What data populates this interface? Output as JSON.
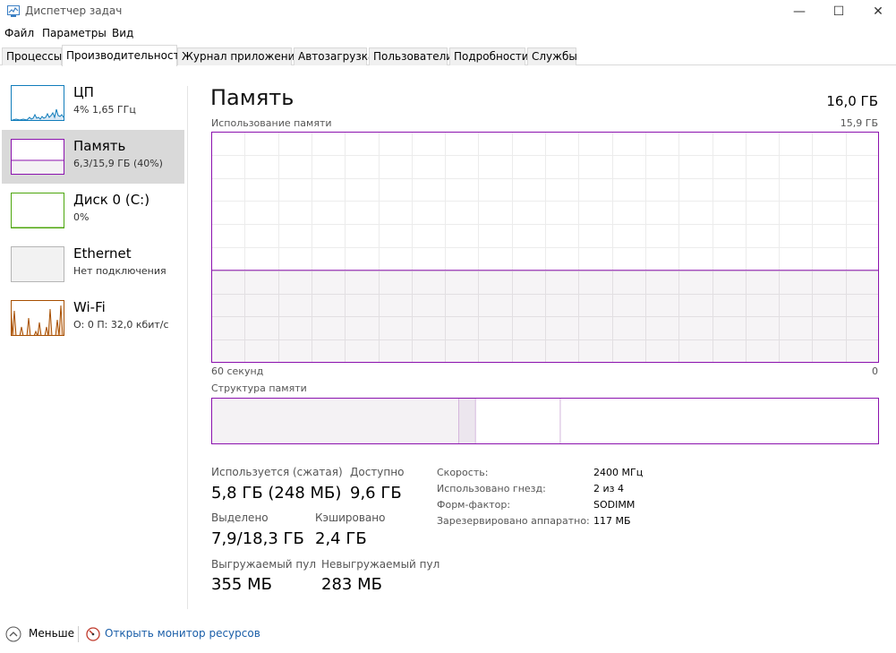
{
  "window": {
    "title": "Диспетчер задач",
    "minimize": "—",
    "maximize": "☐",
    "close": "✕"
  },
  "menu": [
    "Файл",
    "Параметры",
    "Вид"
  ],
  "tabs": [
    "Процессы",
    "Производительность",
    "Журнал приложений",
    "Автозагрузка",
    "Пользователи",
    "Подробности",
    "Службы"
  ],
  "active_tab": "Производительность",
  "sidebar": [
    {
      "title": "ЦП",
      "sub": "4%  1,65 ГГц",
      "color": "#117dbb"
    },
    {
      "title": "Память",
      "sub": "6,3/15,9 ГБ (40%)",
      "color": "#8b12ae",
      "fill_fraction": 0.4
    },
    {
      "title": "Диск 0 (C:)",
      "sub": "0%",
      "color": "#4da60c"
    },
    {
      "title": "Ethernet",
      "sub": "Нет подключения",
      "color": "#aaaaaa"
    },
    {
      "title": "Wi-Fi",
      "sub": "О: 0 П: 32,0 кбит/с",
      "color": "#a74f01"
    }
  ],
  "main": {
    "title": "Память",
    "total": "16,0 ГБ",
    "graph_label": "Использование памяти",
    "graph_max": "15,9 ГБ",
    "graph_left": "60 секунд",
    "graph_right": "0",
    "graph_usage_fraction": 0.4,
    "structure_label": "Структура памяти",
    "structure": {
      "in_use_fraction": 0.37,
      "modified_fraction": 0.025,
      "standby_fraction": 0.127
    },
    "stats": {
      "in_use_label": "Используется (сжатая)",
      "in_use_value": "5,8 ГБ (248 МБ)",
      "available_label": "Доступно",
      "available_value": "9,6 ГБ",
      "committed_label": "Выделено",
      "committed_value": "7,9/18,3 ГБ",
      "cached_label": "Кэшировано",
      "cached_value": "2,4 ГБ",
      "paged_label": "Выгружаемый пул",
      "paged_value": "355 МБ",
      "nonpaged_label": "Невыгружаемый пул",
      "nonpaged_value": "283 МБ"
    },
    "details": [
      {
        "label": "Скорость:",
        "value": "2400 МГц"
      },
      {
        "label": "Использовано гнезд:",
        "value": "2 из 4"
      },
      {
        "label": "Форм-фактор:",
        "value": "SODIMM"
      },
      {
        "label": "Зарезервировано аппаратно:",
        "value": "117 МБ"
      }
    ]
  },
  "footer": {
    "less": "Меньше",
    "resmon": "Открыть монитор ресурсов",
    "link_color": "#1a5ea8"
  },
  "accent": "#8b12ae"
}
